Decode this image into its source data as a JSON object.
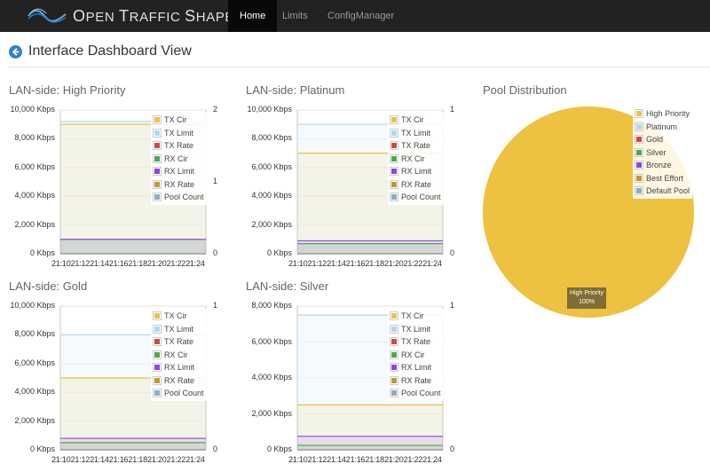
{
  "navbar": {
    "brand": {
      "o": "O",
      "pen": "PEN ",
      "t": "T",
      "raffic": "RAFFIC ",
      "s": "S",
      "haper": "HAPER"
    },
    "items": [
      {
        "label": "Home",
        "active": true
      },
      {
        "label": "Limits",
        "active": false
      },
      {
        "label": "ConfigManager",
        "active": false
      }
    ]
  },
  "page": {
    "title": "Interface Dashboard View"
  },
  "legend_labels": [
    "TX Cir",
    "TX Limit",
    "TX Rate",
    "RX Cir",
    "RX Limit",
    "RX Rate",
    "Pool Count"
  ],
  "legend_colors": [
    "#edc240",
    "#afd8f8",
    "#cb4b4b",
    "#4da74d",
    "#9440ed",
    "#bd9b33",
    "#8cacc6"
  ],
  "charts": [
    {
      "title": "LAN-side: High Priority",
      "yticks": [
        "10,000 Kbps",
        "8,000 Kbps",
        "6,000 Kbps",
        "4,000 Kbps",
        "2,000 Kbps",
        "0 Kbps"
      ],
      "rticks": [
        "2",
        "1",
        "0"
      ],
      "xticks": [
        "21:10",
        "21:12",
        "21:14",
        "21:16",
        "21:18",
        "21:20",
        "21:22",
        "21:24"
      ]
    },
    {
      "title": "LAN-side: Platinum",
      "yticks": [
        "10,000 Kbps",
        "8,000 Kbps",
        "6,000 Kbps",
        "4,000 Kbps",
        "2,000 Kbps",
        "0 Kbps"
      ],
      "rticks": [
        "1",
        "0"
      ],
      "xticks": [
        "21:10",
        "21:12",
        "21:14",
        "21:16",
        "21:18",
        "21:20",
        "21:22",
        "21:24"
      ]
    },
    {
      "title": "LAN-side: Gold",
      "yticks": [
        "10,000 Kbps",
        "8,000 Kbps",
        "6,000 Kbps",
        "4,000 Kbps",
        "2,000 Kbps",
        "0 Kbps"
      ],
      "rticks": [
        "1",
        "0"
      ],
      "xticks": [
        "21:10",
        "21:12",
        "21:14",
        "21:16",
        "21:18",
        "21:20",
        "21:22",
        "21:24"
      ]
    },
    {
      "title": "LAN-side: Silver",
      "yticks": [
        "8,000 Kbps",
        "6,000 Kbps",
        "4,000 Kbps",
        "2,000 Kbps",
        "0 Kbps"
      ],
      "rticks": [
        "1",
        "0"
      ],
      "xticks": [
        "21:10",
        "21:12",
        "21:14",
        "21:16",
        "21:18",
        "21:20",
        "21:22",
        "21:24"
      ]
    }
  ],
  "chart_data": [
    {
      "type": "area",
      "title": "LAN-side: High Priority",
      "x": [
        "21:10",
        "21:24"
      ],
      "ylim": [
        0,
        10000
      ],
      "y2lim": [
        0,
        2
      ],
      "series": [
        {
          "name": "TX Cir",
          "values": [
            9000,
            9000
          ]
        },
        {
          "name": "TX Limit",
          "values": [
            9200,
            9200
          ]
        },
        {
          "name": "TX Rate",
          "values": [
            0,
            0
          ]
        },
        {
          "name": "RX Cir",
          "values": [
            1000,
            1000
          ]
        },
        {
          "name": "RX Limit",
          "values": [
            1000,
            1000
          ]
        },
        {
          "name": "RX Rate",
          "values": [
            0,
            0
          ]
        },
        {
          "name": "Pool Count",
          "values": [
            0,
            0
          ]
        }
      ]
    },
    {
      "type": "area",
      "title": "LAN-side: Platinum",
      "x": [
        "21:10",
        "21:24"
      ],
      "ylim": [
        0,
        10000
      ],
      "y2lim": [
        0,
        1
      ],
      "series": [
        {
          "name": "TX Cir",
          "values": [
            7000,
            7000
          ]
        },
        {
          "name": "TX Limit",
          "values": [
            9000,
            9000
          ]
        },
        {
          "name": "TX Rate",
          "values": [
            0,
            0
          ]
        },
        {
          "name": "RX Cir",
          "values": [
            700,
            700
          ]
        },
        {
          "name": "RX Limit",
          "values": [
            900,
            900
          ]
        },
        {
          "name": "RX Rate",
          "values": [
            0,
            0
          ]
        },
        {
          "name": "Pool Count",
          "values": [
            0,
            0
          ]
        }
      ]
    },
    {
      "type": "area",
      "title": "LAN-side: Gold",
      "x": [
        "21:10",
        "21:24"
      ],
      "ylim": [
        0,
        10000
      ],
      "y2lim": [
        0,
        1
      ],
      "series": [
        {
          "name": "TX Cir",
          "values": [
            5000,
            5000
          ]
        },
        {
          "name": "TX Limit",
          "values": [
            8000,
            8000
          ]
        },
        {
          "name": "TX Rate",
          "values": [
            0,
            0
          ]
        },
        {
          "name": "RX Cir",
          "values": [
            500,
            500
          ]
        },
        {
          "name": "RX Limit",
          "values": [
            800,
            800
          ]
        },
        {
          "name": "RX Rate",
          "values": [
            0,
            0
          ]
        },
        {
          "name": "Pool Count",
          "values": [
            0,
            0
          ]
        }
      ]
    },
    {
      "type": "area",
      "title": "LAN-side: Silver",
      "x": [
        "21:10",
        "21:24"
      ],
      "ylim": [
        0,
        8000
      ],
      "y2lim": [
        0,
        1
      ],
      "series": [
        {
          "name": "TX Cir",
          "values": [
            2500,
            2500
          ]
        },
        {
          "name": "TX Limit",
          "values": [
            7500,
            7500
          ]
        },
        {
          "name": "TX Rate",
          "values": [
            0,
            0
          ]
        },
        {
          "name": "RX Cir",
          "values": [
            250,
            250
          ]
        },
        {
          "name": "RX Limit",
          "values": [
            750,
            750
          ]
        },
        {
          "name": "RX Rate",
          "values": [
            0,
            0
          ]
        },
        {
          "name": "Pool Count",
          "values": [
            0,
            0
          ]
        }
      ]
    },
    {
      "type": "pie",
      "title": "Pool Distribution",
      "labels": [
        "High Priority",
        "Platinum",
        "Gold",
        "Silver",
        "Bronze",
        "Best Effort",
        "Default Pool"
      ],
      "values": [
        100,
        0,
        0,
        0,
        0,
        0,
        0
      ],
      "colors": [
        "#edc240",
        "#afd8f8",
        "#cb4b4b",
        "#4da74d",
        "#9440ed",
        "#bd9b33",
        "#8cacc6"
      ],
      "slice_label": {
        "name": "High Priority",
        "value": "100%"
      }
    }
  ]
}
